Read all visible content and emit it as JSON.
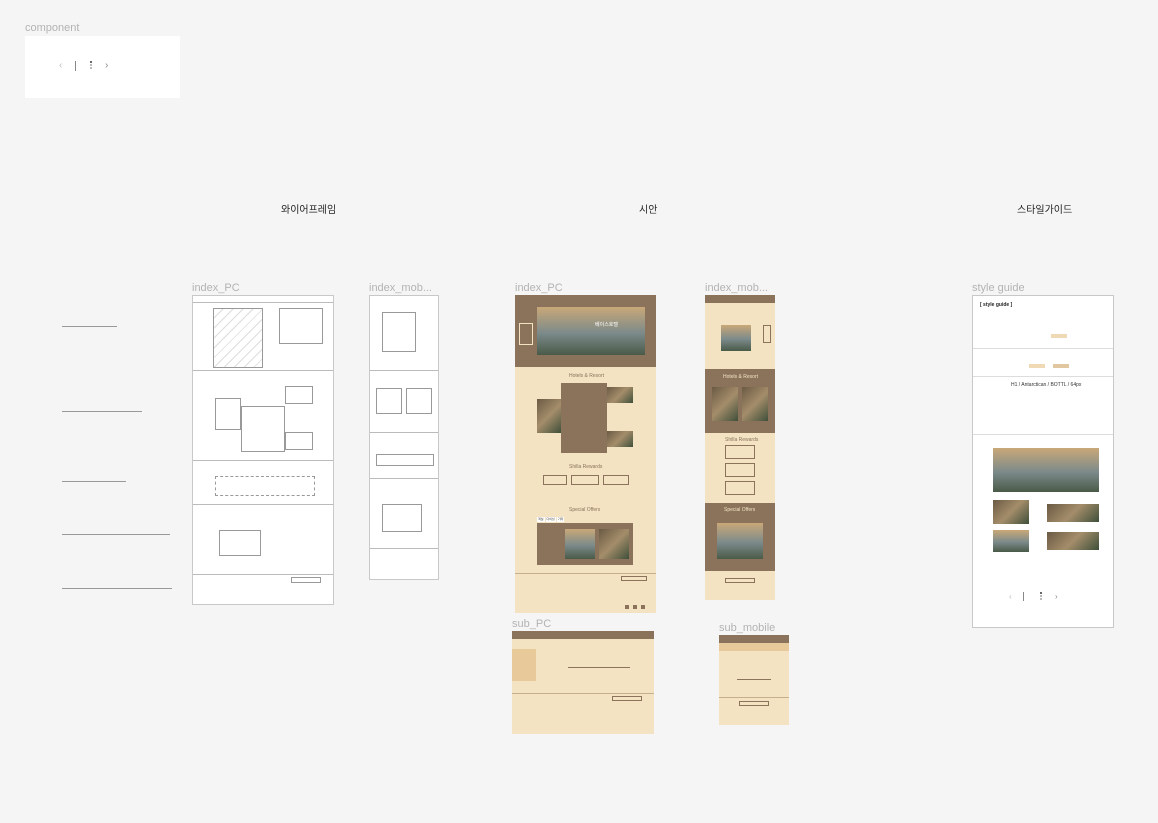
{
  "component": {
    "label": "component",
    "pager_prev": "‹",
    "pager_next": "›"
  },
  "sections": {
    "wireframe": "와이어프레임",
    "mockup": "시안",
    "styleguide": "스타일가이드"
  },
  "frames": {
    "wire_index_pc": "index_PC",
    "wire_index_mobile": "index_mob...",
    "mock_index_pc": "index_PC",
    "mock_index_mobile": "index_mob...",
    "mock_sub_pc": "sub_PC",
    "mock_sub_mobile": "sub_mobile",
    "style_guide": "style guide"
  },
  "mock_pc": {
    "hero_title": "베이스호텔",
    "hotels_heading": "Hotels & Resort",
    "rewards_heading": "Shilla Rewards",
    "offers_heading": "Special Offers",
    "tabs": [
      "객실",
      "다이닝",
      "기타"
    ]
  },
  "mock_mobile": {
    "hotels_heading": "Hotels & Resort",
    "rewards_heading": "Shilla Rewards",
    "offers_heading": "Special Offers"
  },
  "style_guide_frame": {
    "heading": "[ style guide ]",
    "font_sample": "H1 / Antarctican / BOTTL / 64px"
  }
}
